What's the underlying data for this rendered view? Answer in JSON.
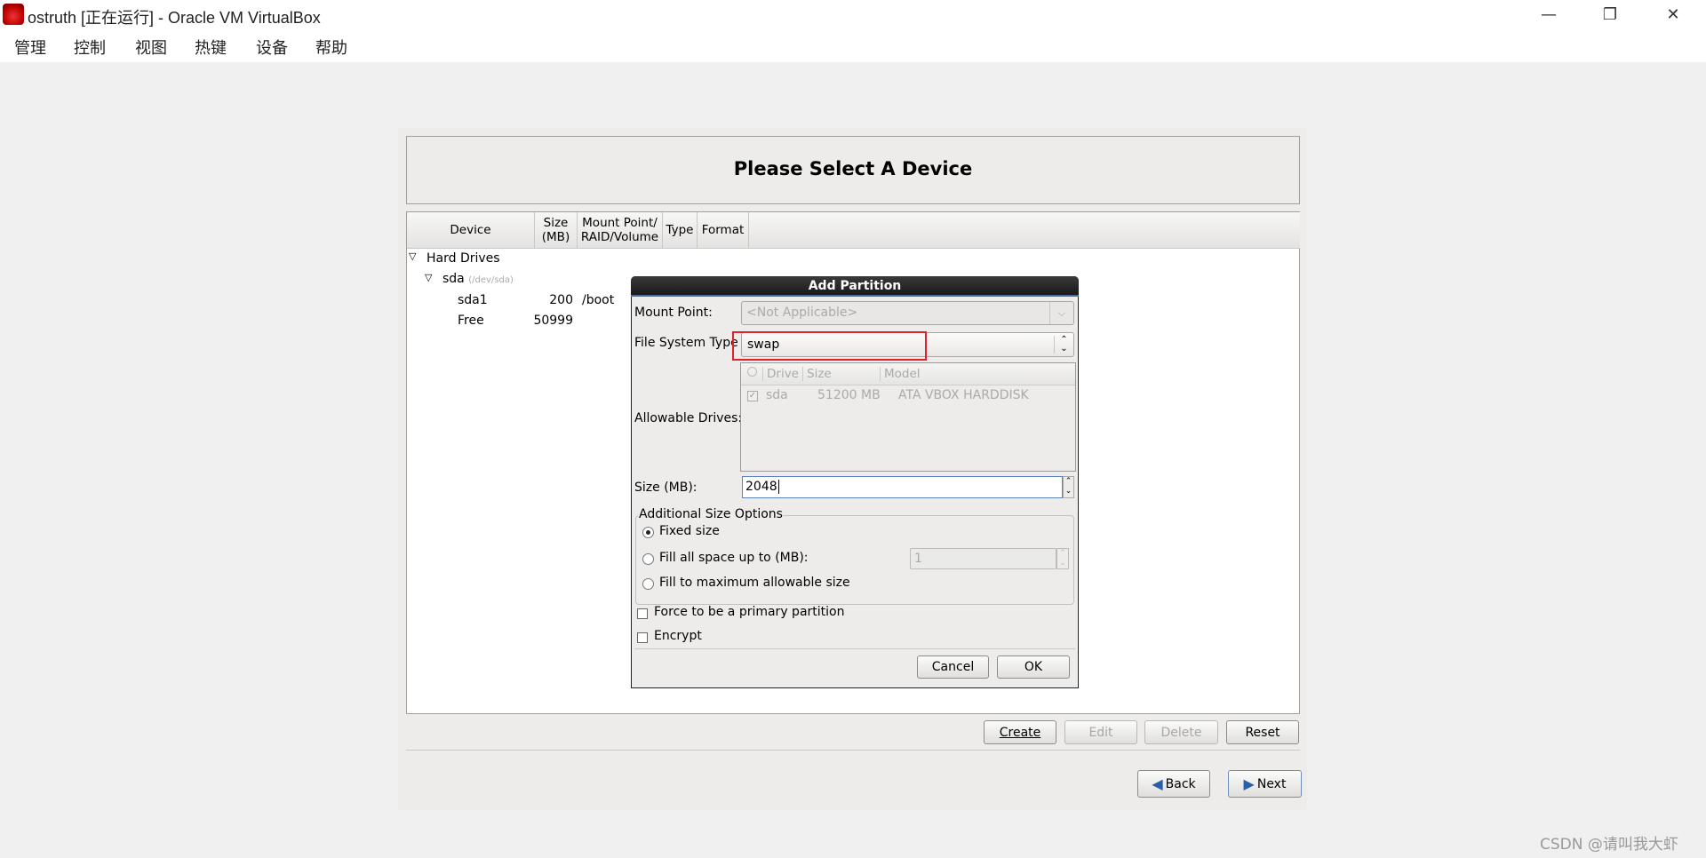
{
  "window": {
    "title": "ostruth [正在运行] - Oracle VM VirtualBox",
    "minimize": "—",
    "restore": "❐",
    "close": "✕"
  },
  "menu": [
    "管理",
    "控制",
    "视图",
    "热键",
    "设备",
    "帮助"
  ],
  "header": {
    "title": "Please Select A Device"
  },
  "table": {
    "columns": [
      "Device",
      "Size\n(MB)",
      "Mount Point/\nRAID/Volume",
      "Type",
      "Format"
    ],
    "rows": [
      {
        "device": "Hard Drives",
        "level": 0
      },
      {
        "device": "sda",
        "sub": "(/dev/sda)",
        "level": 1
      },
      {
        "device": "sda1",
        "size": "200",
        "mount": "/boot",
        "level": 2
      },
      {
        "device": "Free",
        "size": "50999",
        "level": 2
      }
    ]
  },
  "buttons": {
    "create": "Create",
    "edit": "Edit",
    "delete": "Delete",
    "reset": "Reset",
    "back": "Back",
    "next": "Next"
  },
  "dialog": {
    "title": "Add Partition",
    "mount_point_label": "Mount Point:",
    "mount_point_value": "<Not Applicable>",
    "fs_type_label": "File System Type",
    "fs_type_value": "swap",
    "drives_label": "Allowable Drives:",
    "drives_columns": [
      "Drive",
      "Size",
      "Model"
    ],
    "drives": [
      {
        "drive": "sda",
        "size": "51200 MB",
        "model": "ATA VBOX HARDDISK",
        "checked": true
      }
    ],
    "size_label": "Size (MB):",
    "size_value": "2048",
    "options_title": "Additional Size Options",
    "opt_fixed": "Fixed size",
    "opt_fill_upto": "Fill all space up to (MB):",
    "opt_fill_upto_value": "1",
    "opt_fill_max": "Fill to maximum allowable size",
    "selected_option": "Fixed size",
    "force_primary": "Force to be a primary partition",
    "encrypt": "Encrypt",
    "cancel": "Cancel",
    "ok": "OK",
    "highlight_color": "#e0202a"
  },
  "watermark": "CSDN @请叫我大虾"
}
